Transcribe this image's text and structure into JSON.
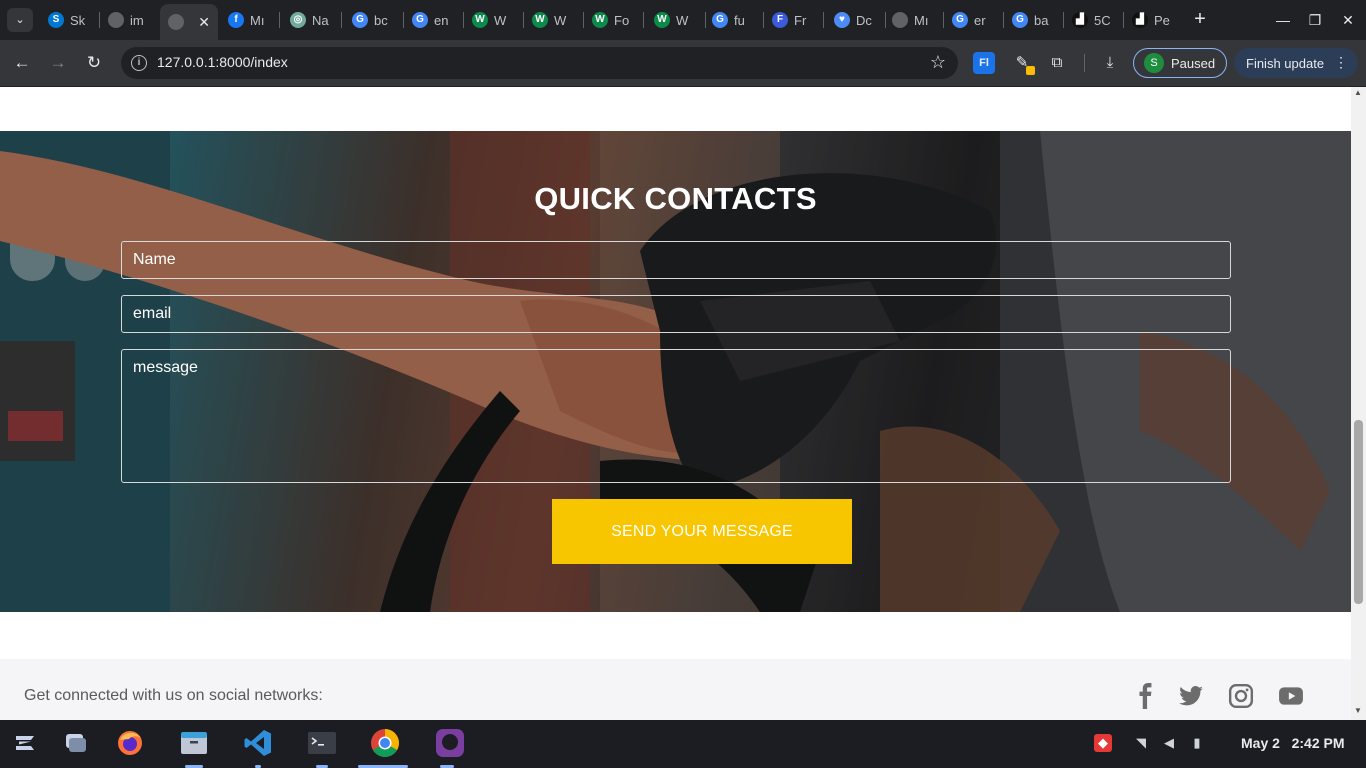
{
  "browser": {
    "tabs": [
      {
        "label": "Sk",
        "icon": "skype-icon",
        "color": "#0078d4",
        "glyph": "S"
      },
      {
        "label": "im",
        "icon": "globe-icon",
        "color": "#5f6368",
        "glyph": ""
      },
      {
        "label": "",
        "icon": "globe-icon",
        "color": "#5f6368",
        "glyph": "",
        "active": true
      },
      {
        "label": "Mı",
        "icon": "facebook-icon",
        "color": "#1877f2",
        "glyph": "f"
      },
      {
        "label": "Na",
        "icon": "openai-icon",
        "color": "#74aa9c",
        "glyph": "◎"
      },
      {
        "label": "bc",
        "icon": "google-icon",
        "color": "#4285f4",
        "glyph": "G"
      },
      {
        "label": "en",
        "icon": "google-icon",
        "color": "#4285f4",
        "glyph": "G"
      },
      {
        "label": "W",
        "icon": "w-icon",
        "color": "#0b8a4a",
        "glyph": "W"
      },
      {
        "label": "W",
        "icon": "w-icon",
        "color": "#0b8a4a",
        "glyph": "W"
      },
      {
        "label": "Fo",
        "icon": "w-icon",
        "color": "#0b8a4a",
        "glyph": "W"
      },
      {
        "label": "W",
        "icon": "w-icon",
        "color": "#0b8a4a",
        "glyph": "W"
      },
      {
        "label": "fu",
        "icon": "google-icon",
        "color": "#4285f4",
        "glyph": "G"
      },
      {
        "label": "Fr",
        "icon": "f-app-icon",
        "color": "#3b5bdb",
        "glyph": "F"
      },
      {
        "label": "Dc",
        "icon": "heart-icon",
        "color": "#4c8bf5",
        "glyph": "♥"
      },
      {
        "label": "Mı",
        "icon": "globe-icon",
        "color": "#5f6368",
        "glyph": ""
      },
      {
        "label": "er",
        "icon": "google-icon",
        "color": "#4285f4",
        "glyph": "G"
      },
      {
        "label": "ba",
        "icon": "google-icon",
        "color": "#4285f4",
        "glyph": "G"
      },
      {
        "label": "5C",
        "icon": "figure-icon",
        "color": "#111111",
        "glyph": "▟"
      },
      {
        "label": "Pe",
        "icon": "figure-icon",
        "color": "#111111",
        "glyph": "▟"
      }
    ],
    "url": "127.0.0.1:8000/index",
    "profile_letter": "S",
    "profile_status": "Paused",
    "finish_update_label": "Finish update"
  },
  "page": {
    "contact": {
      "title": "QUICK CONTACTS",
      "name_placeholder": "Name",
      "email_placeholder": "email",
      "message_placeholder": "message",
      "send_label": "SEND YOUR MESSAGE"
    },
    "footer": {
      "connect_text": "Get connected with us on social networks:",
      "socials": [
        "facebook-icon",
        "twitter-icon",
        "instagram-icon",
        "youtube-icon"
      ]
    }
  },
  "taskbar": {
    "apps": [
      "zorin-menu-icon",
      "workspaces-icon",
      "firefox-icon",
      "files-icon",
      "vscode-icon",
      "terminal-icon",
      "chrome-icon",
      "github-desktop-icon"
    ],
    "date": "May 2",
    "time": "2:42 PM"
  },
  "colors": {
    "accent_button": "#f7c600",
    "chrome_dark": "#202124",
    "toolbar": "#35363a"
  }
}
